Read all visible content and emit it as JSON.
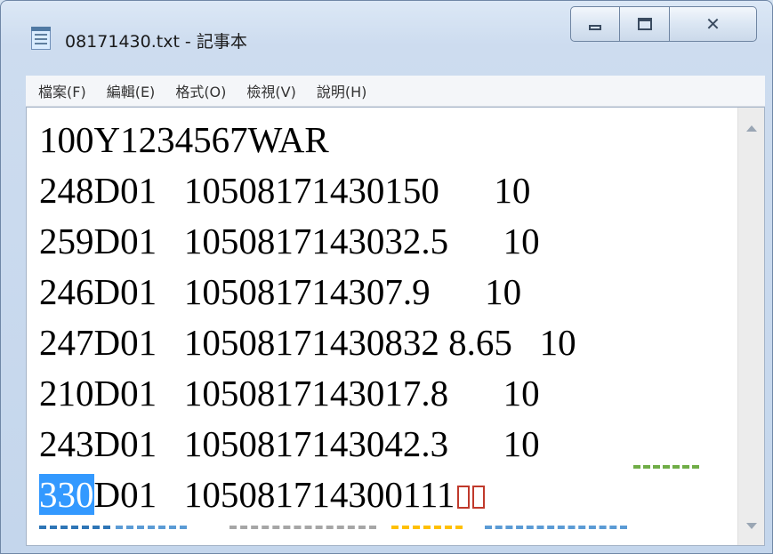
{
  "window": {
    "title": "08171430.txt - 記事本",
    "icon": "notepad-icon"
  },
  "caption_buttons": {
    "minimize_icon": "minimize-icon",
    "maximize_icon": "maximize-icon",
    "close_glyph": "☒"
  },
  "menu": {
    "items": [
      "檔案(F)",
      "編輯(E)",
      "格式(O)",
      "檢視(V)",
      "說明(H)"
    ]
  },
  "document": {
    "lines": [
      "100Y1234567WAR",
      "248D01   10508171430150      10",
      "259D01   1050817143032.5      10",
      "246D01   105081714307.9      10",
      "247D01   10508171430832 8.65   10",
      "210D01   1050817143017.8      10",
      "243D01   1050817143042.3      10"
    ],
    "last_line": {
      "selected": "330",
      "rest": "D01   1050817143001​11"
    }
  },
  "annotations": {
    "colors": {
      "blue": "#2e75b6",
      "teal": "#5b9bd5",
      "gray": "#a6a6a6",
      "yellow": "#ffc000",
      "green": "#70ad47",
      "red": "#c0392b",
      "selection": "#3399ff"
    }
  }
}
